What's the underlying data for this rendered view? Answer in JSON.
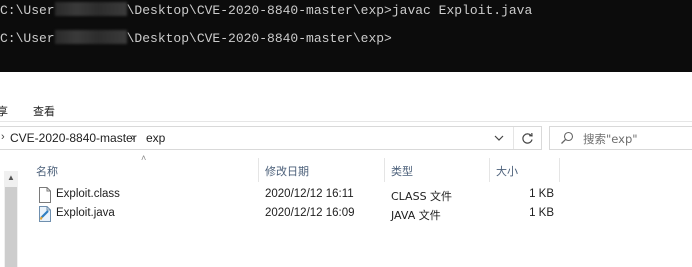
{
  "console": {
    "line1_prefix": "C:\\User",
    "line1_suffix": "\\Desktop\\CVE-2020-8840-master\\exp>javac Exploit.java",
    "line2_prefix": "C:\\User",
    "line2_suffix": "\\Desktop\\CVE-2020-8840-master\\exp>"
  },
  "ribbon": {
    "tab_share": "享",
    "tab_view": "查看"
  },
  "address": {
    "crumb_root": "CVE-2020-8840-master",
    "crumb_sep": "›",
    "crumb_current": "exp",
    "dropdown_icon": "chevron-down-icon",
    "refresh_icon": "refresh-icon"
  },
  "search": {
    "placeholder": "搜索\"exp\""
  },
  "columns": {
    "name": "名称",
    "date": "修改日期",
    "type": "类型",
    "size": "大小"
  },
  "files": [
    {
      "name": "Exploit.class",
      "date": "2020/12/12 16:11",
      "type": "CLASS 文件",
      "size": "1 KB",
      "icon": "file-icon"
    },
    {
      "name": "Exploit.java",
      "date": "2020/12/12 16:09",
      "type": "JAVA 文件",
      "size": "1 KB",
      "icon": "java-file-icon"
    }
  ],
  "colors": {
    "console_bg": "#0c0c0c",
    "console_fg": "#cccccc",
    "header_text": "#4c607a"
  }
}
